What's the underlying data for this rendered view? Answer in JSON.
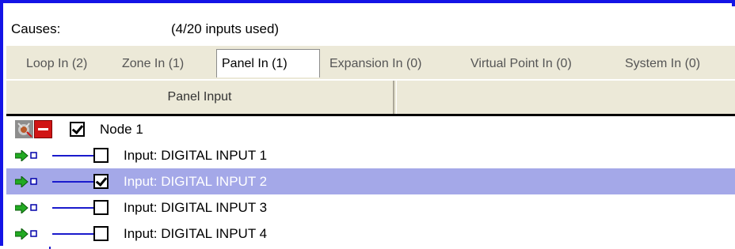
{
  "header": {
    "causes_label": "Causes:",
    "inputs_used": "(4/20 inputs used)"
  },
  "tabs": [
    {
      "label": "Loop In (2)",
      "active": false
    },
    {
      "label": "Zone In (1)",
      "active": false
    },
    {
      "label": "Panel In (1)",
      "active": true
    },
    {
      "label": "Expansion In (0)",
      "active": false
    },
    {
      "label": "Virtual Point In (0)",
      "active": false
    },
    {
      "label": "System In (0)",
      "active": false
    }
  ],
  "grid": {
    "column_header": "Panel Input",
    "node": {
      "label": "Node 1",
      "checked": true,
      "icon": "node-device-icon",
      "expander": "collapse-minus-icon"
    },
    "inputs": [
      {
        "label": "Input: DIGITAL INPUT 1",
        "checked": false,
        "selected": false,
        "icon": "digital-input-arrow-icon"
      },
      {
        "label": "Input: DIGITAL INPUT 2",
        "checked": true,
        "selected": true,
        "icon": "digital-input-arrow-icon"
      },
      {
        "label": "Input: DIGITAL INPUT 3",
        "checked": false,
        "selected": false,
        "icon": "digital-input-arrow-icon"
      },
      {
        "label": "Input: DIGITAL INPUT 4",
        "checked": false,
        "selected": false,
        "icon": "digital-input-arrow-icon"
      }
    ]
  },
  "colors": {
    "frame_border": "#1414e6",
    "selection": "#a4a8e8",
    "collapse_button": "#d01414",
    "tree_line": "#1a1acc",
    "input_arrow": "#22aa22"
  }
}
